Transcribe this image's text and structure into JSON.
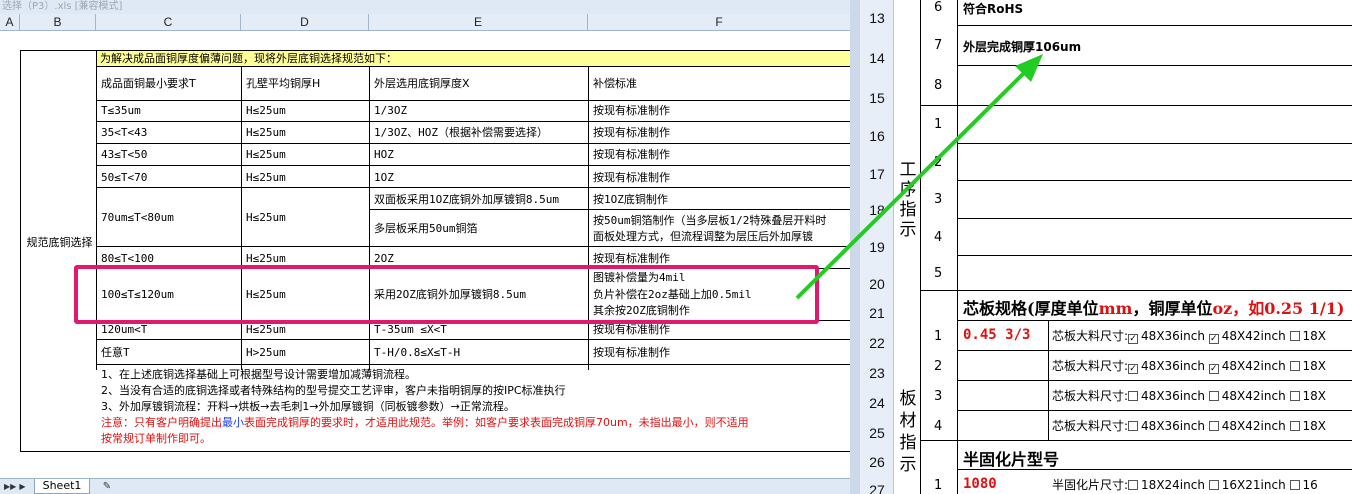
{
  "window": {
    "title": "选择（P3）.xls  [兼容模式]"
  },
  "columns": [
    "A",
    "B",
    "C",
    "D",
    "E",
    "F"
  ],
  "spec": {
    "side_label": "规范底铜选择",
    "banner": "为解决成品面铜厚度偏薄问题，现将外层底铜选择规范如下：",
    "headers": [
      "成品面铜最小要求T",
      "孔壁平均铜厚H",
      "外层选用底铜厚度X",
      "补偿标准"
    ],
    "rows": [
      [
        "T≤35um",
        "H≤25um",
        "1/3OZ",
        "按现有标准制作"
      ],
      [
        "35<T<43",
        "H≤25um",
        "1/3OZ、HOZ（根据补偿需要选择）",
        "按现有标准制作"
      ],
      [
        "43≤T<50",
        "H≤25um",
        "HOZ",
        "按现有标准制作"
      ],
      [
        "50≤T<70",
        "H≤25um",
        "1OZ",
        "按现有标准制作"
      ],
      [
        "70um≤T<80um",
        "H≤25um",
        "双面板采用1OZ底铜外加厚镀铜8.5um",
        "按1OZ底铜制作"
      ],
      [
        "",
        "",
        "多层板采用50um铜箔",
        "按50um铜箔制作（当多层板1/2特殊叠层开料时"
      ],
      [
        "",
        "",
        "",
        "面板处理方式，但流程调整为层压后外加厚镀"
      ],
      [
        "80≤T<100",
        "H≤25um",
        "2OZ",
        "按现有标准制作"
      ],
      [
        "100≤T≤120um",
        "H≤25um",
        "采用2OZ底铜外加厚镀铜8.5um",
        "图镀补偿量为4mil"
      ],
      [
        "",
        "",
        "",
        "负片补偿在2oz基础上加0.5mil"
      ],
      [
        "",
        "",
        "",
        "其余按2OZ底铜制作"
      ],
      [
        "120um<T",
        "H≤25um",
        "T-35um ≤X<T",
        "按现有标准制作"
      ],
      [
        "任意T",
        "H>25um",
        "T-H/0.8≤X≤T-H",
        "按现有标准制作"
      ]
    ],
    "notes": [
      "1、在上述底铜选择基础上可根据型号设计需要增加减薄铜流程。",
      "2、当没有合适的底铜选择或者特殊结构的型号提交工艺评审，客户未指明铜厚的按IPC标准执行",
      "3、外加厚镀铜流程：开料→烘板→去毛刺1→外加厚镀铜（同板镀参数）→正常流程。"
    ],
    "note_red_1": "注意：只有客户明确提出",
    "note_blue": "最小",
    "note_red_2": "表面完成铜厚的要求时，才适用此规范。举例：如客户要求表面完成铜厚70um，未指出最小，则不适用",
    "note_red_3": "按常规订单制作即可。"
  },
  "sheet_tab": "Sheet1",
  "right": {
    "row_numbers": [
      "13",
      "14",
      "15",
      "16",
      "17",
      "18",
      "19",
      "20",
      "21",
      "22",
      "23",
      "24",
      "25",
      "26",
      "27"
    ],
    "items_top": [
      {
        "num": "6",
        "text": "符合RoHS"
      },
      {
        "num": "7",
        "text": "外层完成铜厚106um"
      },
      {
        "num": "8",
        "text": ""
      }
    ],
    "process_label": "工序指示",
    "process_nums": [
      "1",
      "2",
      "3",
      "4",
      "5"
    ],
    "board_label": "板材指示",
    "core_spec_prefix": "芯板规格(厚度单位",
    "core_spec_mm": "mm",
    "core_spec_mid": "，铜厚单位",
    "core_spec_oz": "oz",
    "core_spec_suffix_red": "，如0.25 1/1)",
    "core_rows": [
      {
        "num": "1",
        "value": "0.45 3/3",
        "label": "芯板大料尺寸:",
        "opt1": "48X36inch",
        "c1": true,
        "opt2": "48X42inch",
        "c2": true,
        "opt3": "18X"
      },
      {
        "num": "2",
        "value": "",
        "label": "芯板大料尺寸:",
        "opt1": "48X36inch",
        "c1": true,
        "opt2": "48X42inch",
        "c2": true,
        "opt3": "18X"
      },
      {
        "num": "3",
        "value": "",
        "label": "芯板大料尺寸:",
        "opt1": "48X36inch",
        "c1": false,
        "opt2": "48X42inch",
        "c2": false,
        "opt3": "18X"
      },
      {
        "num": "4",
        "value": "",
        "label": "芯板大料尺寸:",
        "opt1": "48X36inch",
        "c1": false,
        "opt2": "48X42inch",
        "c2": false,
        "opt3": "18X"
      }
    ],
    "prepreg_title": "半固化片型号",
    "prepreg_row": {
      "num": "1",
      "value": "1080",
      "label": "半固化片尺寸:",
      "opt1": "18X24inch",
      "opt2": "16X21inch",
      "opt3": "16"
    }
  },
  "colors": {
    "magenta": "#e0186e",
    "arrow": "#22cc22",
    "banner": "#ffff99",
    "red": "#e01010"
  }
}
